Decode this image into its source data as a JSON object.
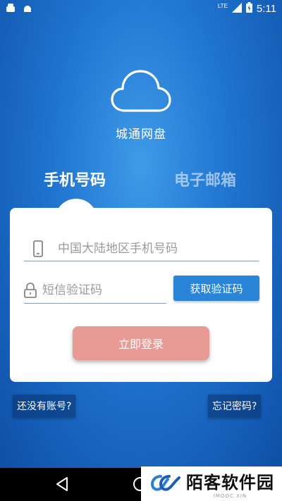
{
  "status_bar": {
    "network": "LTE",
    "time": "5:11"
  },
  "app": {
    "name": "城通网盘"
  },
  "tabs": [
    {
      "label": "手机号码",
      "active": true
    },
    {
      "label": "电子邮箱",
      "active": false
    }
  ],
  "form": {
    "phone_placeholder": "中国大陆地区手机号码",
    "code_placeholder": "短信验证码",
    "get_code_label": "获取验证码",
    "login_label": "立即登录"
  },
  "links": {
    "register": "还没有账号?",
    "forgot": "忘记密码?"
  },
  "watermark": {
    "title": "陌客软件园",
    "subtitle": "IMOOC.XIN"
  },
  "colors": {
    "background": "#2a80d8",
    "get_code_button": "#2a85d6",
    "login_button": "#e89a95"
  },
  "icons": [
    "android-icon",
    "android-icon",
    "signal-icon",
    "battery-icon",
    "cloud-icon",
    "phone-icon",
    "lock-icon",
    "back-icon",
    "home-icon"
  ]
}
